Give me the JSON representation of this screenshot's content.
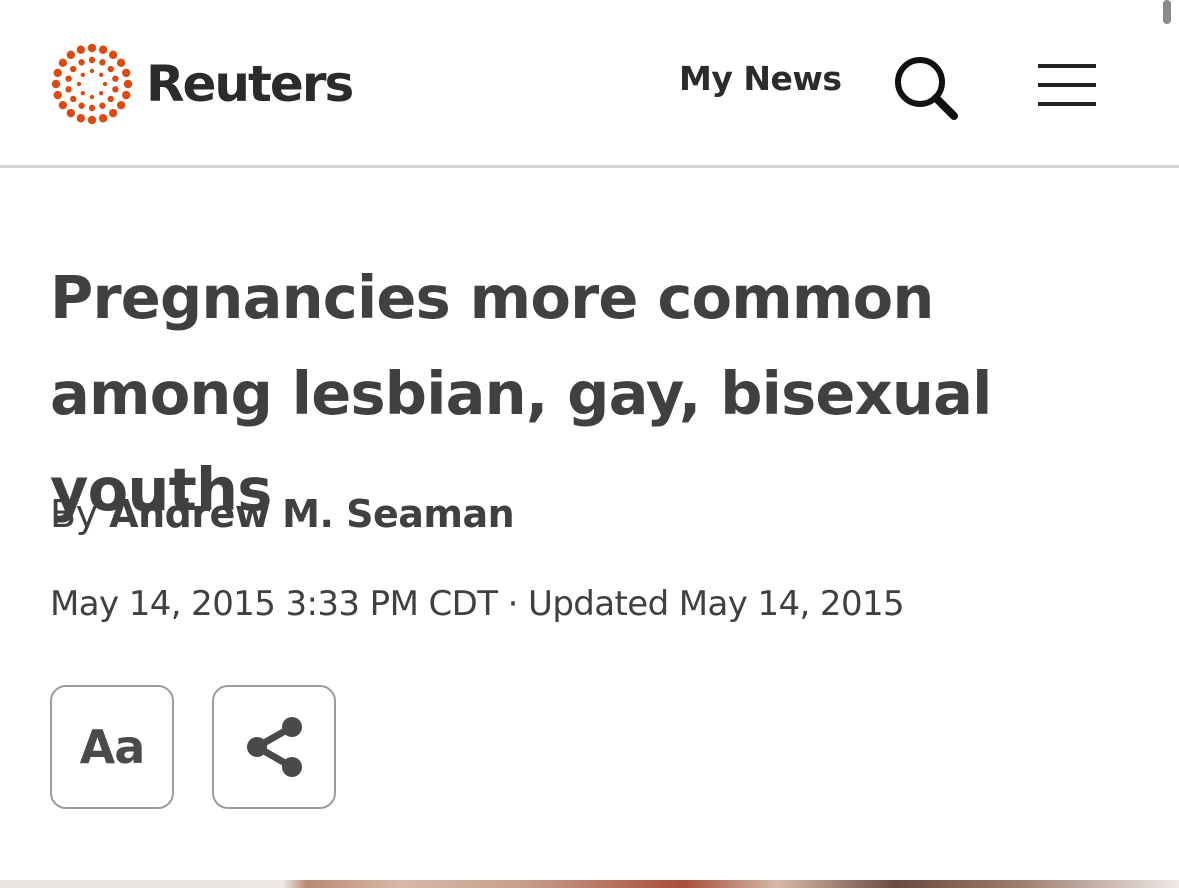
{
  "header": {
    "brand": "Reuters",
    "brand_color": "#dc4a14",
    "my_news_label": "My News",
    "search_icon": "search-icon",
    "menu_icon": "hamburger-menu-icon"
  },
  "article": {
    "headline": "Pregnancies more common among lesbian, gay, bisexual youths",
    "byline_prefix": "By",
    "author": "Andrew M. Seaman",
    "dateline": "May 14, 2015 3:33 PM CDT · Updated May 14, 2015"
  },
  "actions": {
    "text_size_label": "Aa",
    "share_icon": "share-icon"
  }
}
